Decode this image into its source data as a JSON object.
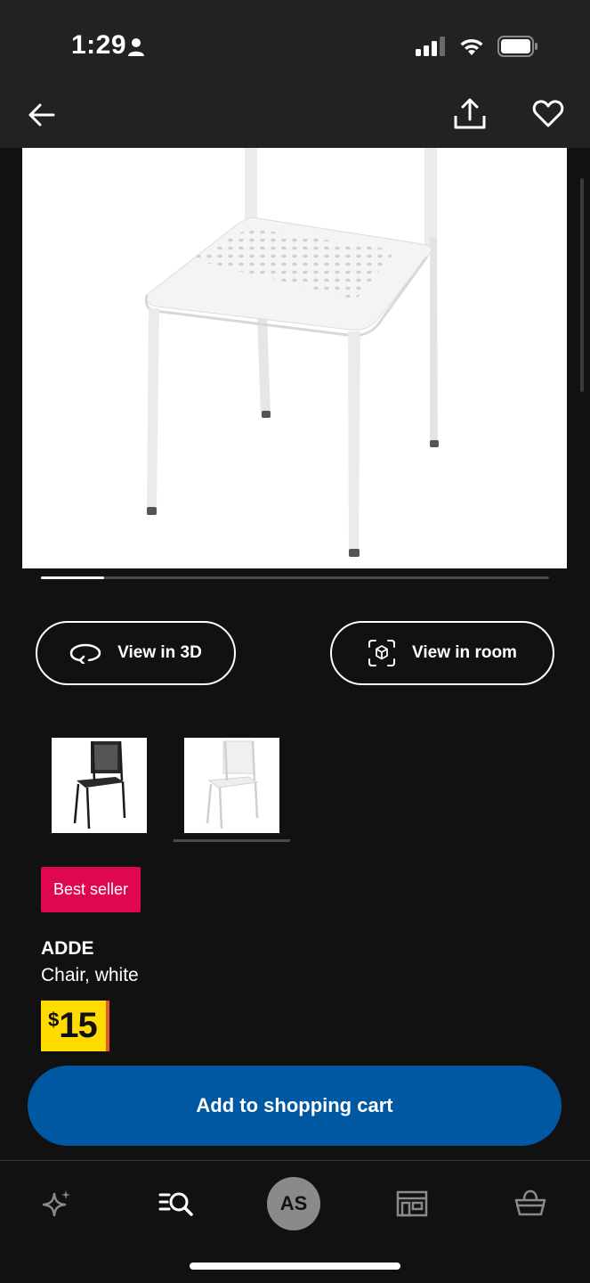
{
  "status": {
    "time": "1:29"
  },
  "product": {
    "badge": "Best seller",
    "name": "ADDE",
    "description": "Chair, white",
    "price_currency": "$",
    "price_value": "15"
  },
  "actions": {
    "view_3d": "View in 3D",
    "view_room": "View in room",
    "add_to_cart": "Add to shopping cart"
  },
  "gallery": {
    "image_count": 8,
    "current_index": 1
  },
  "tabs": {
    "profile_initials": "AS"
  },
  "colors": {
    "background": "#111111",
    "bar": "#222222",
    "accent_blue": "#0058a3",
    "badge_red": "#e00751",
    "price_yellow": "#ffdb00"
  },
  "icons": [
    "back-arrow-icon",
    "share-icon",
    "heart-icon",
    "rotate-3d-icon",
    "ar-cube-icon",
    "sparkle-icon",
    "search-list-icon",
    "store-icon",
    "basket-icon"
  ]
}
